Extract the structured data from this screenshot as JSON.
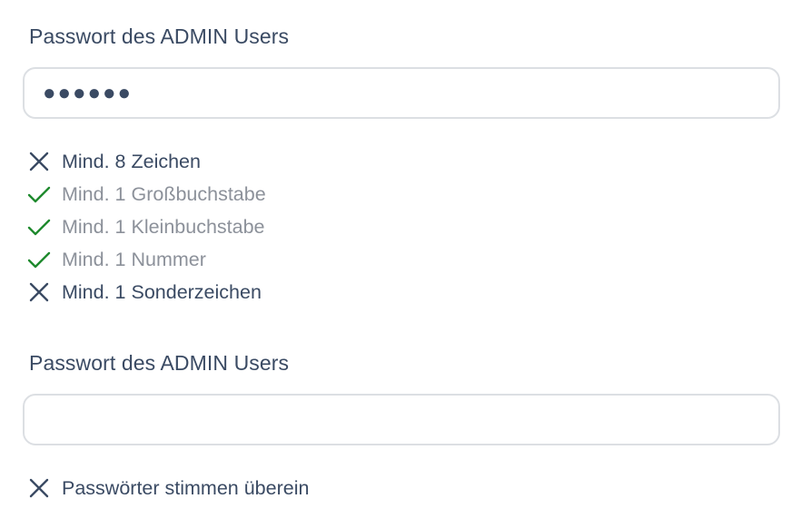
{
  "password": {
    "label": "Passwort des ADMIN Users",
    "value": "●●●●●●",
    "rules": [
      {
        "text": "Mind. 8 Zeichen",
        "status": "fail",
        "icon": "cross-icon"
      },
      {
        "text": "Mind. 1 Großbuchstabe",
        "status": "pass",
        "icon": "check-icon"
      },
      {
        "text": "Mind. 1 Kleinbuchstabe",
        "status": "pass",
        "icon": "check-icon"
      },
      {
        "text": "Mind. 1 Nummer",
        "status": "pass",
        "icon": "check-icon"
      },
      {
        "text": "Mind. 1 Sonderzeichen",
        "status": "fail",
        "icon": "cross-icon"
      }
    ]
  },
  "confirm": {
    "label": "Passwort des ADMIN Users",
    "value": "",
    "rules": [
      {
        "text": "Passwörter stimmen überein",
        "status": "fail",
        "icon": "cross-icon"
      }
    ]
  },
  "colors": {
    "text": "#3a4a63",
    "pass_icon": "#1f8a2e",
    "fail_icon": "#3a4a63",
    "pass_text": "#8c919a",
    "input_border": "#dcdfe3"
  }
}
